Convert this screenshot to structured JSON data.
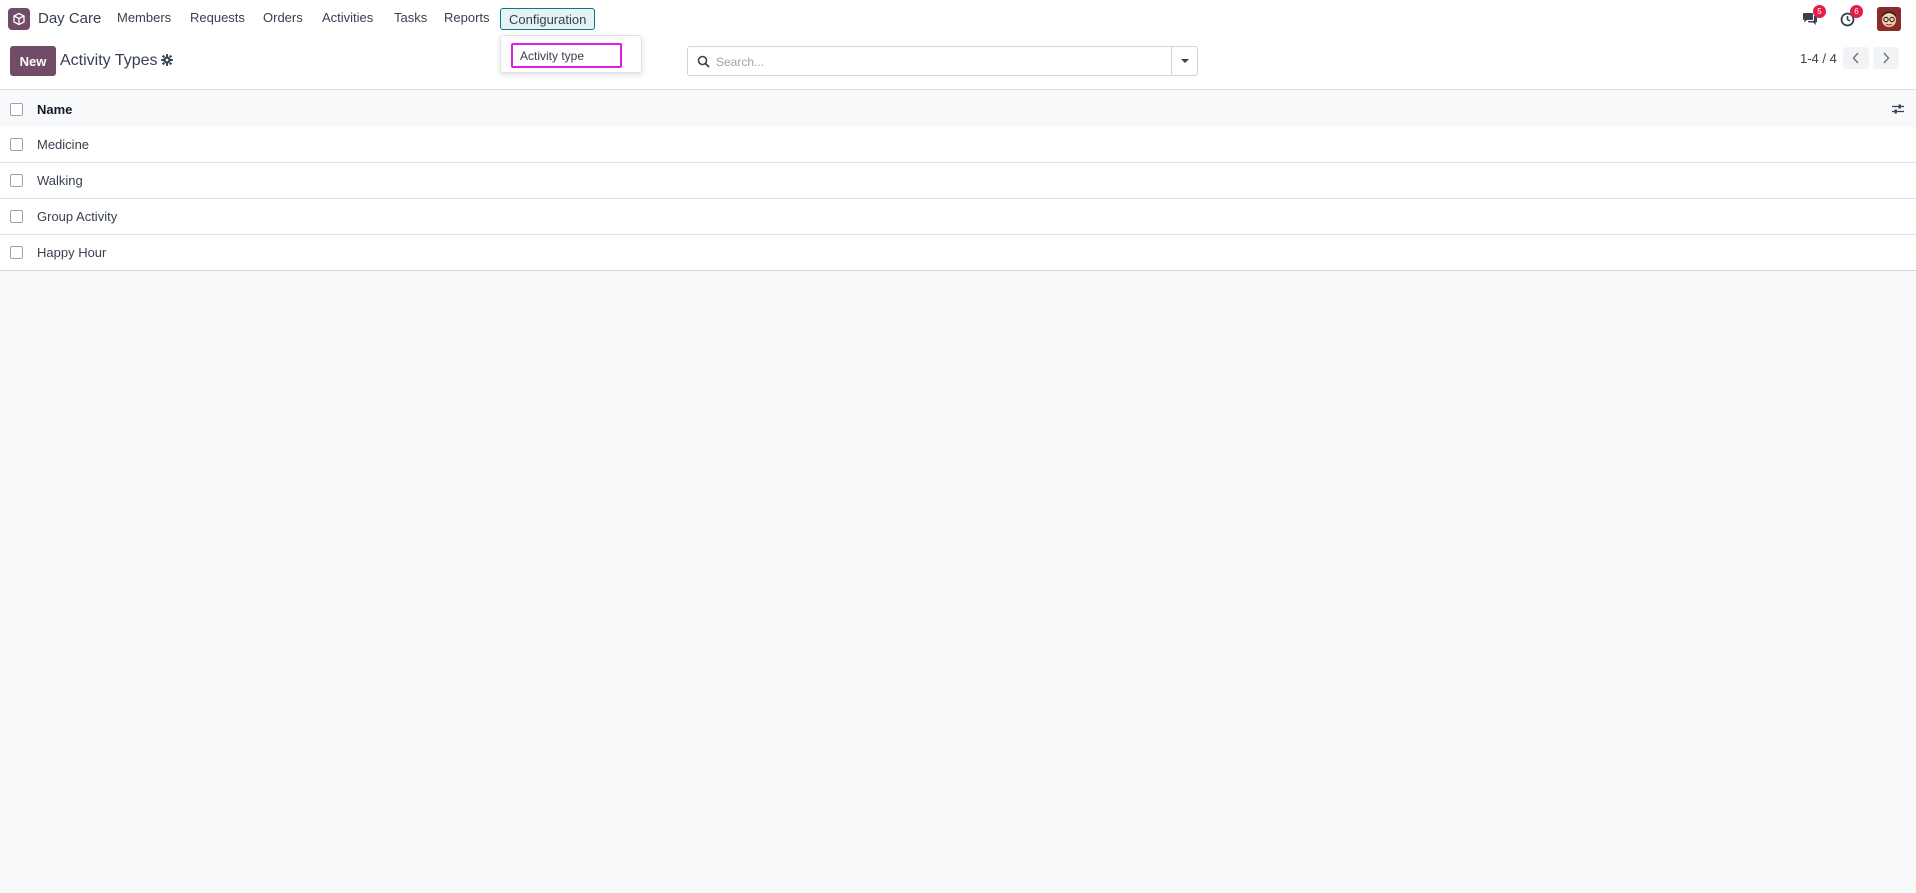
{
  "navbar": {
    "app_name": "Day Care",
    "menu": [
      "Members",
      "Requests",
      "Orders",
      "Activities",
      "Tasks",
      "Reports"
    ],
    "active_menu": "Configuration",
    "messages_count": "5",
    "activities_count": "6"
  },
  "dropdown": {
    "items": [
      "Activity type"
    ]
  },
  "control_panel": {
    "new_label": "New",
    "title": "Activity Types",
    "search_placeholder": "Search...",
    "pager": "1-4 / 4"
  },
  "list": {
    "columns": [
      "Name"
    ],
    "rows": [
      "Medicine",
      "Walking",
      "Group Activity",
      "Happy Hour"
    ]
  },
  "colors": {
    "brand": "#714b67",
    "active_menu_border": "#017e84",
    "badge": "#e11d48",
    "highlight": "#e01ee0"
  }
}
